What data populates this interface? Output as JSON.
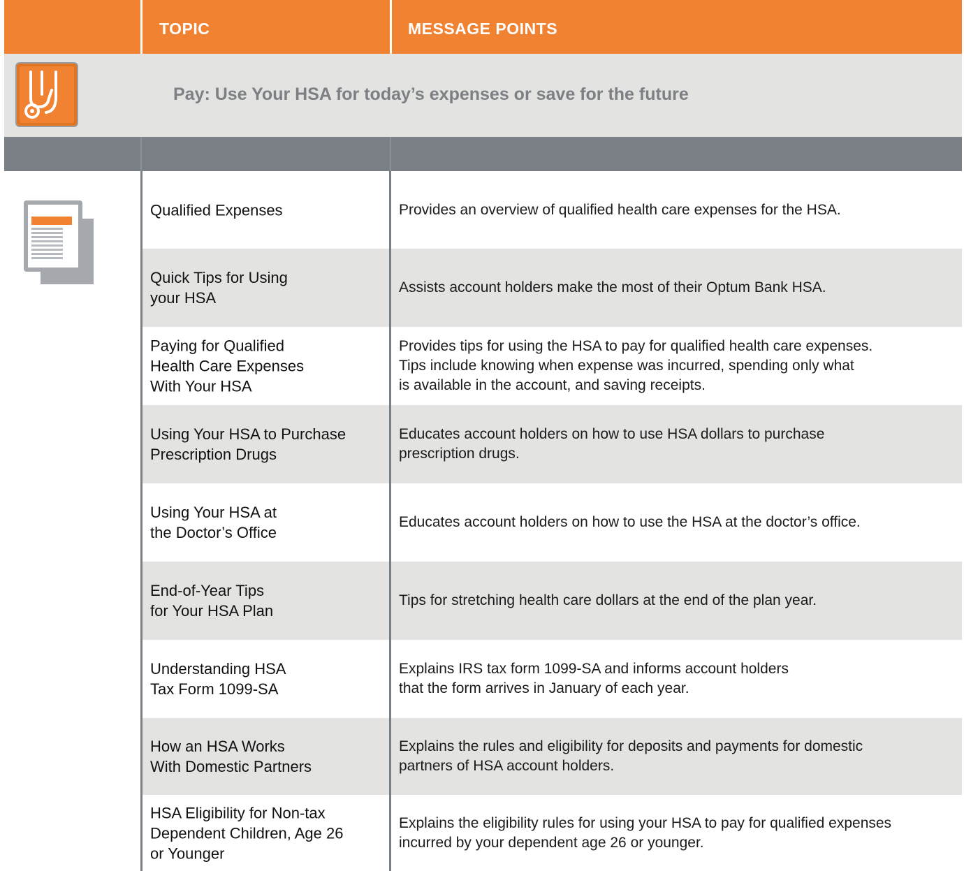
{
  "colors": {
    "accent": "#f08231",
    "band_light": "#e3e4e2",
    "band_dark": "#7b7f86",
    "section_title": "#7c7f83"
  },
  "header": {
    "topic_label": "TOPIC",
    "messages_label": "MESSAGE POINTS"
  },
  "section": {
    "icon": "stethoscope-icon",
    "title": "Pay: Use Your HSA for today’s expenses or save for the future"
  },
  "document_icon": "document-stack-icon",
  "rows": [
    {
      "topic": "Qualified Expenses",
      "message": "Provides an overview of qualified health care expenses for the HSA."
    },
    {
      "topic": "Quick Tips for Using\nyour HSA",
      "message": "Assists account holders make the most of their Optum Bank HSA."
    },
    {
      "topic": "Paying for Qualified\nHealth Care Expenses\nWith Your HSA",
      "message": "Provides tips for using the HSA to pay for qualified health care expenses.\nTips include knowing when expense was incurred, spending only what\nis available in the account, and saving receipts."
    },
    {
      "topic": "Using Your HSA to Purchase\nPrescription Drugs",
      "message": "Educates account holders on how to use HSA dollars to purchase\nprescription drugs."
    },
    {
      "topic": "Using Your HSA at\nthe Doctor’s Office",
      "message": "Educates account holders on how to use the HSA at the doctor’s office."
    },
    {
      "topic": "End-of-Year Tips\nfor Your HSA Plan",
      "message": "Tips for stretching health care dollars at the end of the plan year."
    },
    {
      "topic": "Understanding HSA\nTax Form 1099-SA",
      "message": "Explains IRS tax form 1099-SA and informs account holders\nthat the form arrives in January of each year."
    },
    {
      "topic": "How an HSA Works\nWith Domestic Partners",
      "message": "Explains the rules and eligibility for deposits and payments for domestic\npartners of HSA account holders."
    },
    {
      "topic": "HSA Eligibility for Non-tax\nDependent Children, Age 26\nor Younger",
      "message": "Explains the eligibility rules for using your HSA to pay for qualified expenses\nincurred by your dependent age 26 or younger."
    }
  ]
}
